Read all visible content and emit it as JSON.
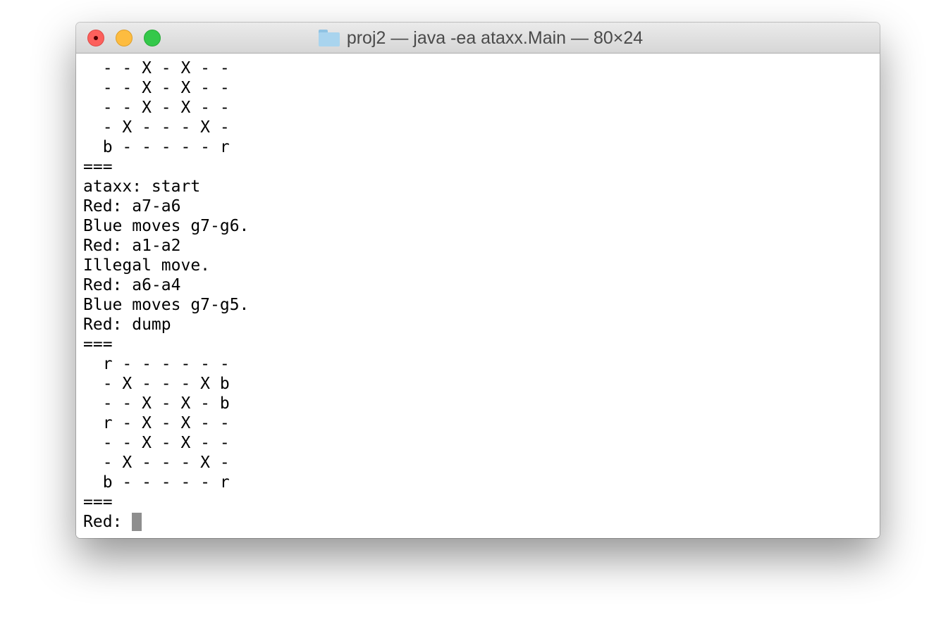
{
  "window": {
    "title": "proj2 — java -ea ataxx.Main — 80×24",
    "folder_icon": "folder-icon",
    "buttons": {
      "close": "close-button",
      "minimize": "minimize-button",
      "zoom": "zoom-button"
    }
  },
  "terminal": {
    "lines": [
      "  - - X - X - -",
      "  - - X - X - -",
      "  - - X - X - -",
      "  - X - - - X -",
      "  b - - - - - r",
      "===",
      "ataxx: start",
      "Red: a7-a6",
      "Blue moves g7-g6.",
      "Red: a1-a2",
      "Illegal move.",
      "Red: a6-a4",
      "Blue moves g7-g5.",
      "Red: dump",
      "===",
      "  r - - - - - -",
      "  - X - - - X b",
      "  - - X - X - b",
      "  r - X - X - -",
      "  - - X - X - -",
      "  - X - - - X -",
      "  b - - - - - r",
      "==="
    ],
    "prompt": "Red: "
  },
  "colors": {
    "close": "#fc605c",
    "minimize": "#fdbc40",
    "zoom": "#34c84a",
    "cursor": "#8e8e8e",
    "text": "#000000"
  }
}
